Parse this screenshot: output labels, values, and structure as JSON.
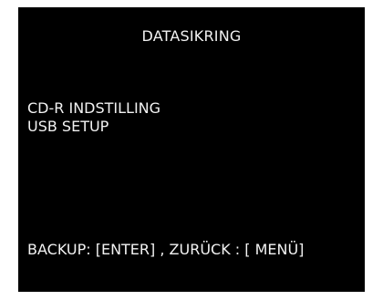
{
  "screen": {
    "title": "DATASIKRING",
    "menu_items": [
      {
        "label": "CD-R INDSTILLING"
      },
      {
        "label": "USB SETUP"
      }
    ],
    "footer_hint": "BACKUP: [ENTER] ,  ZURÜCK : [ MENÜ]",
    "background_color": "#000000",
    "text_color": "#f2f2f2"
  }
}
